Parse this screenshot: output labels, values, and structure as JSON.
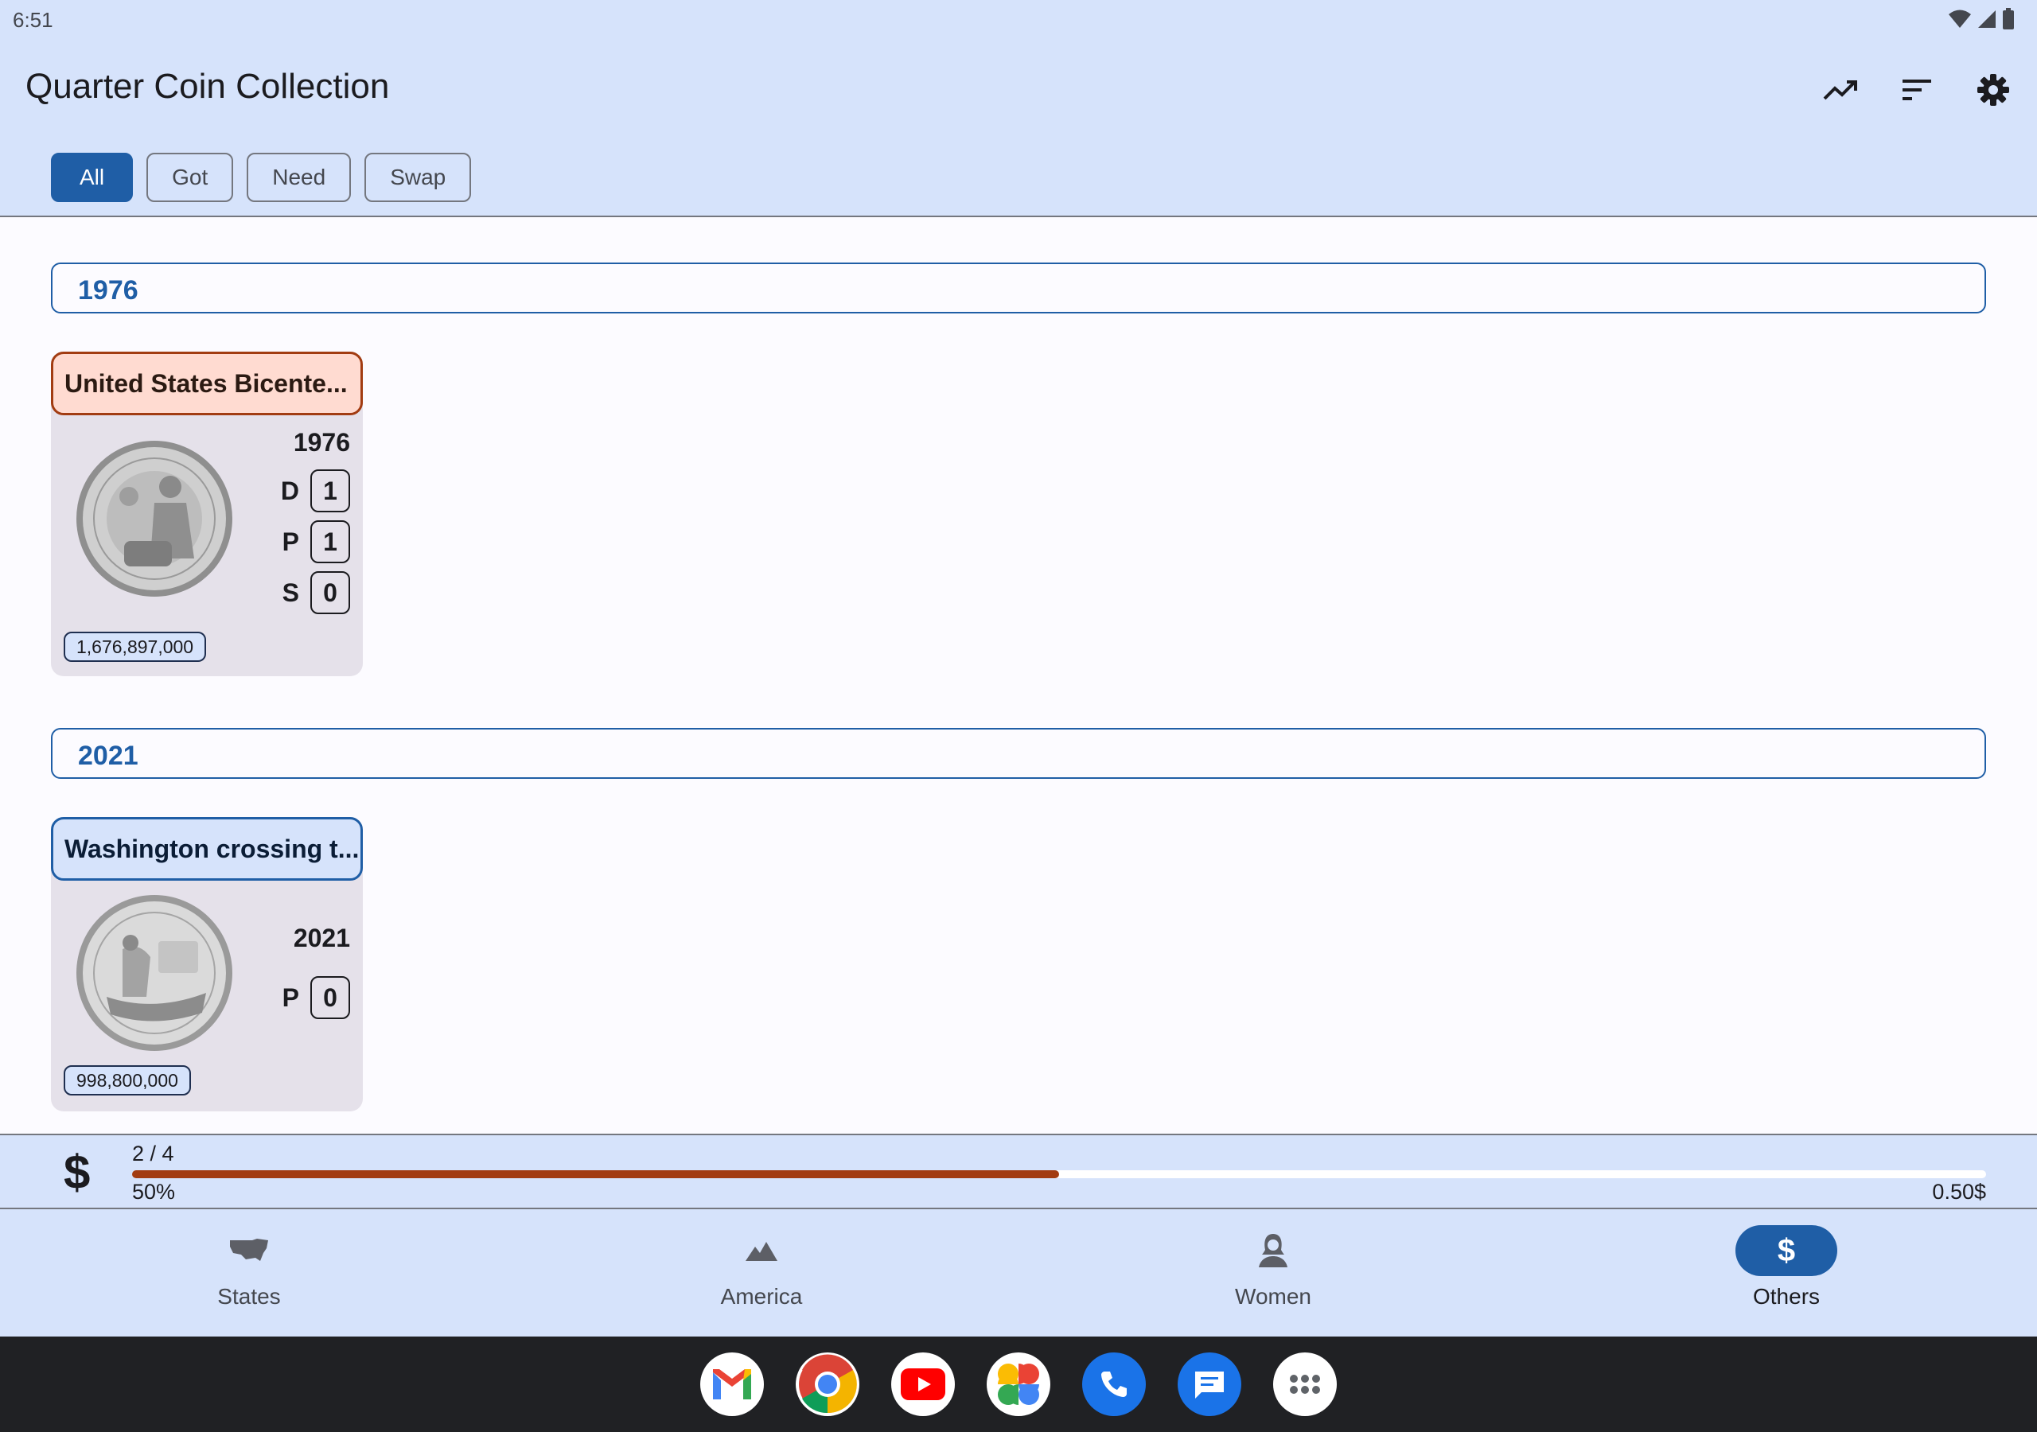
{
  "status_bar": {
    "time": "6:51"
  },
  "app_bar": {
    "title": "Quarter Coin Collection"
  },
  "filters": {
    "all": "All",
    "got": "Got",
    "need": "Need",
    "swap": "Swap"
  },
  "sections": [
    {
      "year": "1976",
      "cards": [
        {
          "title": "United States Bicente...",
          "year": "1976",
          "mints": [
            {
              "mark": "D",
              "count": "1"
            },
            {
              "mark": "P",
              "count": "1"
            },
            {
              "mark": "S",
              "count": "0"
            }
          ],
          "mintage": "1,676,897,000"
        }
      ]
    },
    {
      "year": "2021",
      "cards": [
        {
          "title": "Washington crossing t...",
          "year": "2021",
          "mints": [
            {
              "mark": "P",
              "count": "0"
            }
          ],
          "mintage": "998,800,000"
        }
      ]
    }
  ],
  "progress": {
    "symbol": "$",
    "count": "2 / 4",
    "percent_label": "50%",
    "percent_value": 50,
    "value": "0.50$"
  },
  "bottom_nav": {
    "states": "States",
    "america": "America",
    "women": "Women",
    "others": "Others",
    "active": "others"
  },
  "taskbar_apps": [
    "gmail-icon",
    "chrome-icon",
    "youtube-icon",
    "photos-icon",
    "phone-icon",
    "messages-icon",
    "app-drawer-icon"
  ],
  "colors": {
    "accent": "#1f5ea6",
    "surface": "#d6e3fb",
    "progress": "#a23c12",
    "card": "#e5e1ea"
  }
}
